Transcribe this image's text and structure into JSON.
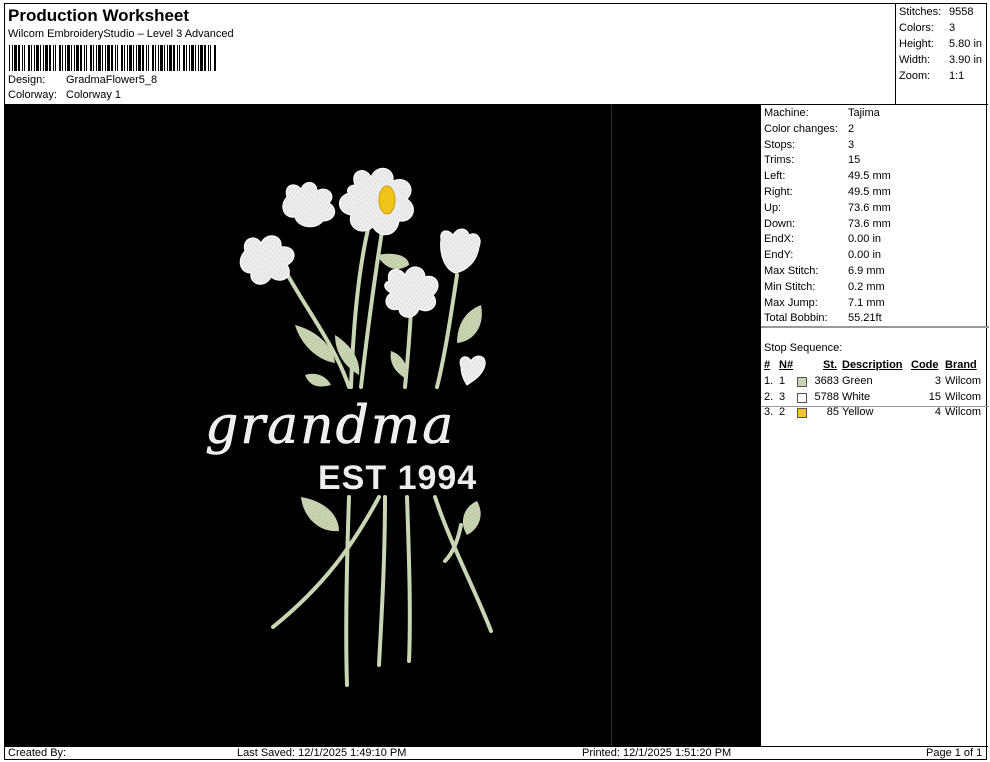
{
  "header": {
    "title": "Production Worksheet",
    "subtitle": "Wilcom EmbroideryStudio – Level 3 Advanced",
    "design_label": "Design:",
    "design_value": "GradmaFlower5_8",
    "colorway_label": "Colorway:",
    "colorway_value": "Colorway 1"
  },
  "summary": [
    {
      "label": "Stitches:",
      "value": "9558"
    },
    {
      "label": "Colors:",
      "value": "3"
    },
    {
      "label": "Height:",
      "value": "5.80 in"
    },
    {
      "label": "Width:",
      "value": "3.90 in"
    },
    {
      "label": "Zoom:",
      "value": "1:1"
    }
  ],
  "design_text": {
    "script": "grandma",
    "est": "EST 1994"
  },
  "machine_info": [
    {
      "label": "Machine:",
      "value": "Tajima"
    },
    {
      "label": "Color changes:",
      "value": "2"
    },
    {
      "label": "Stops:",
      "value": "3"
    },
    {
      "label": "Trims:",
      "value": "15"
    },
    {
      "label": "Left:",
      "value": "49.5 mm"
    },
    {
      "label": "Right:",
      "value": "49.5 mm"
    },
    {
      "label": "Up:",
      "value": "73.6 mm"
    },
    {
      "label": "Down:",
      "value": "73.6 mm"
    },
    {
      "label": "EndX:",
      "value": "0.00 in"
    },
    {
      "label": "EndY:",
      "value": "0.00 in"
    },
    {
      "label": "Max Stitch:",
      "value": "6.9 mm"
    },
    {
      "label": "Min Stitch:",
      "value": "0.2 mm"
    },
    {
      "label": "Max Jump:",
      "value": "7.1 mm"
    },
    {
      "label": "Total Bobbin:",
      "value": "55.21ft"
    }
  ],
  "stop_sequence": {
    "title": "Stop Sequence:",
    "headers": {
      "num": "#",
      "n": "N#",
      "st": "St.",
      "desc": "Description",
      "code": "Code",
      "brand": "Brand"
    },
    "rows": [
      {
        "num": "1.",
        "n": "1",
        "color": "#c9d4b4",
        "st": "3683",
        "desc": "Green",
        "code": "3",
        "brand": "Wilcom"
      },
      {
        "num": "2.",
        "n": "3",
        "color": "#ffffff",
        "st": "5788",
        "desc": "White",
        "code": "15",
        "brand": "Wilcom"
      },
      {
        "num": "3.",
        "n": "2",
        "color": "#f5c518",
        "st": "85",
        "desc": "Yellow",
        "code": "4",
        "brand": "Wilcom"
      }
    ]
  },
  "footer": {
    "created": "Created By:",
    "saved": "Last Saved: 12/1/2025 1:49:10 PM",
    "printed": "Printed: 12/1/2025 1:51:20 PM",
    "page": "Page 1 of 1"
  },
  "colors": {
    "stem": "#c9d6b3",
    "petal": "#eeeeee",
    "yellow": "#f0c419",
    "background": "#000000"
  }
}
